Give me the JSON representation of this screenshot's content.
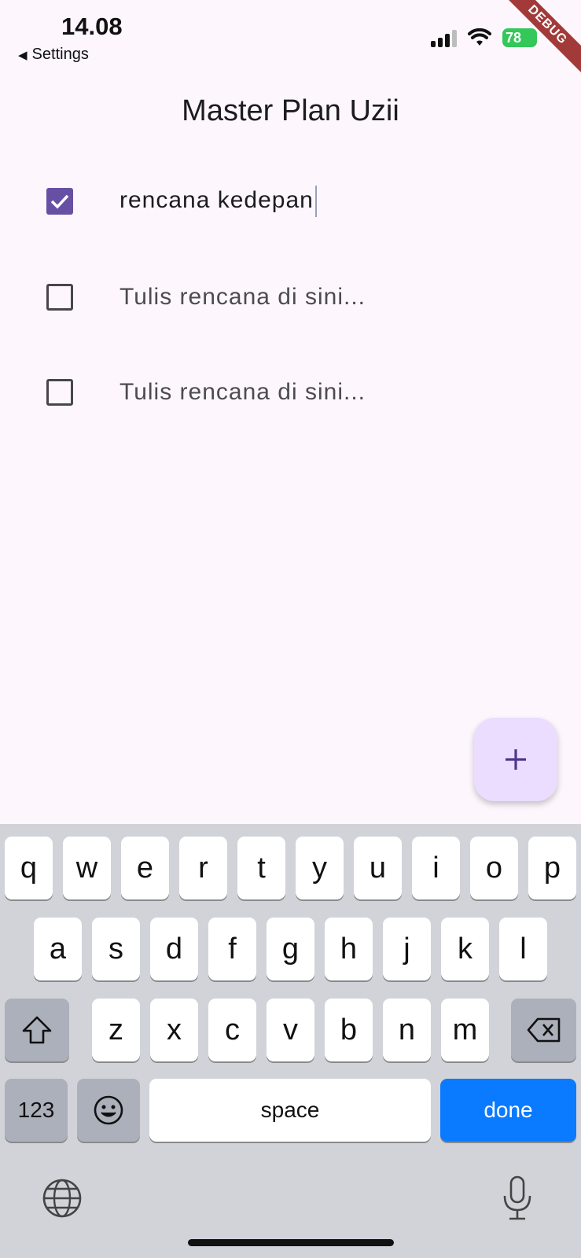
{
  "status_bar": {
    "time": "14.08",
    "back_label": "Settings",
    "battery": "78"
  },
  "debug_banner": "DEBUG",
  "app": {
    "title": "Master Plan Uzii",
    "plans": [
      {
        "text": "rencana kedepan",
        "placeholder": "",
        "checked": true
      },
      {
        "text": "",
        "placeholder": "Tulis rencana di sini...",
        "checked": false
      },
      {
        "text": "",
        "placeholder": "Tulis rencana di sini...",
        "checked": false
      }
    ],
    "fab_icon": "plus-icon"
  },
  "keyboard": {
    "row1": [
      "q",
      "w",
      "e",
      "r",
      "t",
      "y",
      "u",
      "i",
      "o",
      "p"
    ],
    "row2": [
      "a",
      "s",
      "d",
      "f",
      "g",
      "h",
      "j",
      "k",
      "l"
    ],
    "row3": [
      "z",
      "x",
      "c",
      "v",
      "b",
      "n",
      "m"
    ],
    "shift_icon": "shift-icon",
    "backspace_icon": "backspace-icon",
    "numbers_label": "123",
    "emoji_icon": "emoji-icon",
    "space_label": "space",
    "done_label": "done",
    "globe_icon": "globe-icon",
    "mic_icon": "microphone-icon"
  },
  "colors": {
    "background": "#fdf7fd",
    "checkbox_checked": "#6750a4",
    "fab": "#eaddff",
    "done_key": "#0a7aff",
    "keyboard_bg": "#d1d3d9"
  }
}
